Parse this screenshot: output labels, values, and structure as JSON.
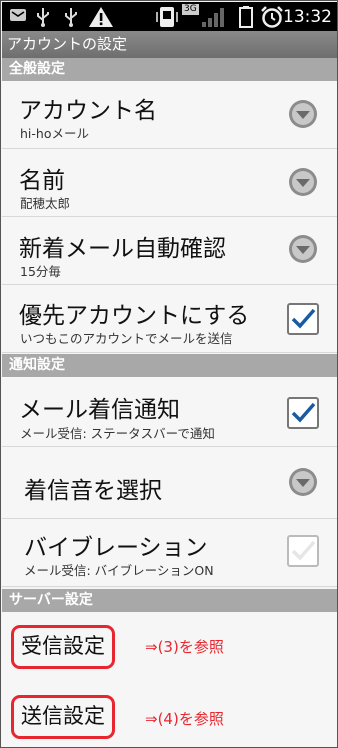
{
  "status_bar": {
    "time": "13:32",
    "network": "3G",
    "icons": [
      "notification-icon",
      "usb-icon",
      "usb-icon",
      "warning-icon",
      "vibrate-icon",
      "signal-icon",
      "battery-icon",
      "alarm-icon"
    ]
  },
  "title": "アカウントの設定",
  "sections": {
    "general": "全般設定",
    "notification": "通知設定",
    "server": "サーバー設定"
  },
  "general_items": {
    "account_name": {
      "title": "アカウント名",
      "value": "hi-hoメール"
    },
    "name": {
      "title": "名前",
      "value": "配穂太郎"
    },
    "auto_check": {
      "title": "新着メール自動確認",
      "value": "15分毎"
    },
    "default_account": {
      "title": "優先アカウントにする",
      "value": "いつもこのアカウントでメールを送信",
      "checked": true
    }
  },
  "notification_items": {
    "mail_notify": {
      "title": "メール着信通知",
      "value": "メール受信: ステータスバーで通知",
      "checked": true
    },
    "ringtone": {
      "title": "着信音を選択"
    },
    "vibration": {
      "title": "バイブレーション",
      "value": "メール受信: バイブレーションON",
      "checked": false
    }
  },
  "server_items": {
    "incoming": {
      "title": "受信設定",
      "note": "⇒(3)を参照"
    },
    "outgoing": {
      "title": "送信設定",
      "note": "⇒(4)を参照"
    }
  },
  "colors": {
    "highlight": "#e8262f",
    "check": "#1a5aa0",
    "section": "#a8a8a8"
  }
}
